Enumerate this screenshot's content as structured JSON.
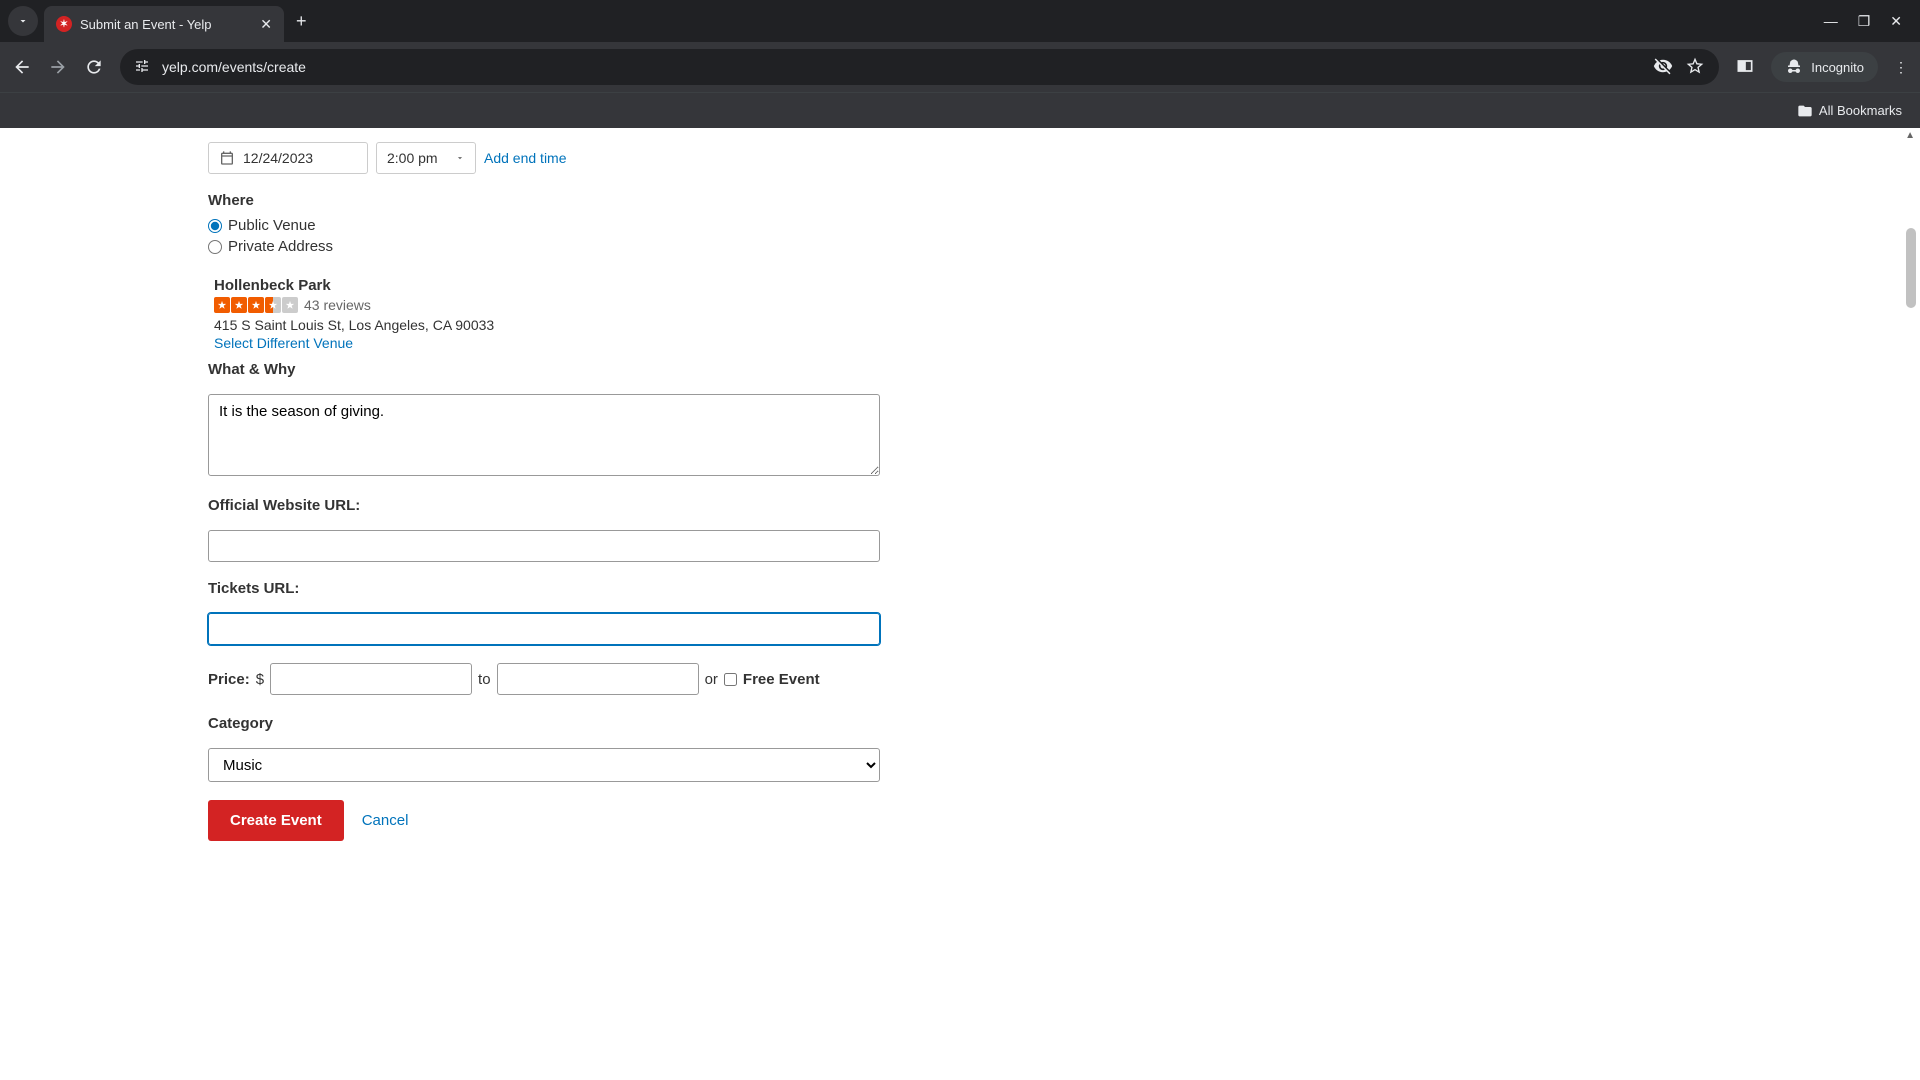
{
  "browser": {
    "tab_title": "Submit an Event - Yelp",
    "url": "yelp.com/events/create",
    "incognito_label": "Incognito",
    "bookmarks_label": "All Bookmarks"
  },
  "form": {
    "date_value": "12/24/2023",
    "time_value": "2:00 pm",
    "add_end_time": "Add end time",
    "where": {
      "title": "Where",
      "public_label": "Public Venue",
      "private_label": "Private Address"
    },
    "venue": {
      "name": "Hollenbeck Park",
      "review_count": "43 reviews",
      "address": "415 S Saint Louis St, Los Angeles, CA 90033",
      "select_different": "Select Different Venue"
    },
    "what_why": {
      "title": "What & Why",
      "value": "It is the season of giving."
    },
    "official_url": {
      "title": "Official Website URL:",
      "value": ""
    },
    "tickets_url": {
      "title": "Tickets URL:",
      "value": ""
    },
    "price": {
      "label": "Price:",
      "currency": "$",
      "to": "to",
      "or": "or",
      "free_label": "Free Event"
    },
    "category": {
      "title": "Category",
      "selected": "Music"
    },
    "create_label": "Create Event",
    "cancel_label": "Cancel"
  }
}
